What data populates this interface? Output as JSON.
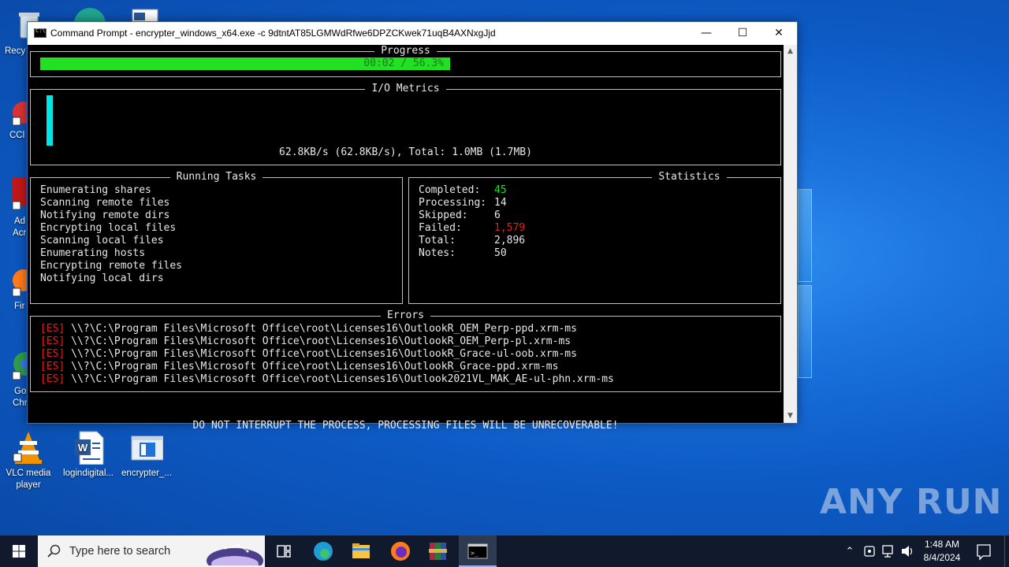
{
  "desktop": {
    "icons": [
      {
        "label": "VLC media player"
      },
      {
        "label": "logindigital..."
      },
      {
        "label": "encrypter_..."
      }
    ],
    "partial_labels": [
      "Recy",
      "CCl",
      "Ad",
      "Acr",
      "Fir",
      "Go",
      "Chr"
    ],
    "watermark": "ANY RUN"
  },
  "window": {
    "title": "Command Prompt - encrypter_windows_x64.exe  -c 9dtntAT85LGMWdRfwe6DPZCKwek71uqB4AXNxgJjd",
    "minimize_glyph": "—",
    "maximize_glyph": "☐",
    "close_glyph": "✕"
  },
  "console": {
    "progress": {
      "title": "Progress",
      "text": "00:02 / 56.3%",
      "fraction": 0.563,
      "bar_color": "#22e022"
    },
    "io_metrics": {
      "title": "I/O Metrics",
      "text": "62.8KB/s (62.8KB/s), Total: 1.0MB (1.7MB)",
      "bar_color": "#00e5e5"
    },
    "running_tasks": {
      "title": "Running Tasks",
      "items": [
        "Enumerating shares",
        "Scanning remote files",
        "Notifying remote dirs",
        "Encrypting local files",
        "Scanning local files",
        "Enumerating hosts",
        "Encrypting remote files",
        "Notifying local dirs"
      ]
    },
    "statistics": {
      "title": "Statistics",
      "rows": [
        {
          "label": "Completed:",
          "value": "45",
          "color": "#22e022"
        },
        {
          "label": "Processing:",
          "value": "14",
          "color": "#e8e8e8"
        },
        {
          "label": "Skipped:",
          "value": "6",
          "color": "#e8e8e8"
        },
        {
          "label": "Failed:",
          "value": "1,579",
          "color": "#e02020"
        },
        {
          "label": "Total:",
          "value": "2,896",
          "color": "#e8e8e8"
        },
        {
          "label": "Notes:",
          "value": "50",
          "color": "#e8e8e8"
        }
      ]
    },
    "errors": {
      "title": "Errors",
      "tag": "[ES]",
      "items": [
        "\\\\?\\C:\\Program Files\\Microsoft Office\\root\\Licenses16\\OutlookR_OEM_Perp-ppd.xrm-ms",
        "\\\\?\\C:\\Program Files\\Microsoft Office\\root\\Licenses16\\OutlookR_OEM_Perp-pl.xrm-ms",
        "\\\\?\\C:\\Program Files\\Microsoft Office\\root\\Licenses16\\OutlookR_Grace-ul-oob.xrm-ms",
        "\\\\?\\C:\\Program Files\\Microsoft Office\\root\\Licenses16\\OutlookR_Grace-ppd.xrm-ms",
        "\\\\?\\C:\\Program Files\\Microsoft Office\\root\\Licenses16\\Outlook2021VL_MAK_AE-ul-phn.xrm-ms"
      ]
    },
    "warning": "DO NOT INTERRUPT THE PROCESS, PROCESSING FILES WILL BE UNRECOVERABLE!"
  },
  "taskbar": {
    "search_placeholder": "Type here to search",
    "apps": [
      "task-view",
      "edge",
      "file-explorer",
      "firefox",
      "winrar",
      "command-prompt"
    ],
    "time": "1:48 AM",
    "date": "8/4/2024"
  }
}
